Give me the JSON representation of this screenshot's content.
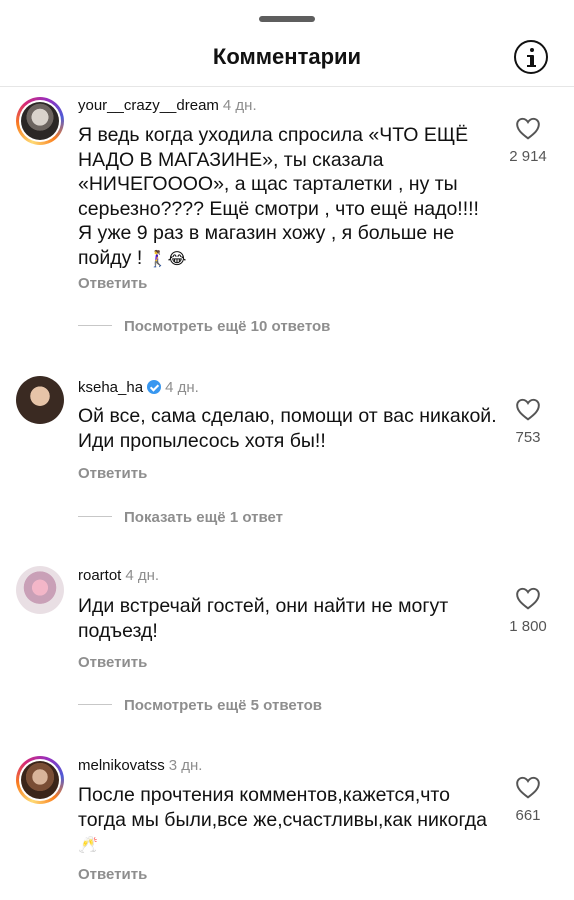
{
  "header": {
    "title": "Комментарии"
  },
  "comments": [
    {
      "username": "your__crazy__dream",
      "age": "4 дн.",
      "text": "Я ведь когда уходила спросила «ЧТО ЕЩЁ НАДО В МАГАЗИНЕ», ты сказала «НИЧЕГОООО», а щас тарталетки , ну ты серьезно???? Ещё смотри , что ещё надо!!!! Я уже 9 раз в магазин хожу , я больше не пойду !",
      "emoji": "🚶‍♀️😂",
      "likes": "2 914",
      "reply_label": "Ответить",
      "more_replies": "Посмотреть ещё 10 ответов",
      "verified": false
    },
    {
      "username": "kseha_ha",
      "age": "4 дн.",
      "text": "Ой все, сама сделаю, помощи от вас никакой. Иди пропылесось хотя бы!!",
      "emoji": "",
      "likes": "753",
      "reply_label": "Ответить",
      "more_replies": "Показать ещё 1 ответ",
      "verified": true
    },
    {
      "username": "roartot",
      "age": "4 дн.",
      "text": "Иди встречай гостей, они найти не могут подъезд!",
      "emoji": "",
      "likes": "1 800",
      "reply_label": "Ответить",
      "more_replies": "Посмотреть ещё 5 ответов",
      "verified": false
    },
    {
      "username": "melnikovatss",
      "age": "3 дн.",
      "text": "После прочтения комментов,кажется,что тогда мы были,все же,счастливы,как никогда",
      "emoji": "🥂",
      "likes": "661",
      "reply_label": "Ответить",
      "more_replies": "",
      "verified": false
    }
  ],
  "icons": {
    "info": "info-icon",
    "like": "heart-outline-icon",
    "verified": "verified-badge-icon"
  },
  "colors": {
    "text": "#111111",
    "muted": "#8e8e8e",
    "verified": "#3897f0",
    "divider": "#e6e6e6"
  }
}
